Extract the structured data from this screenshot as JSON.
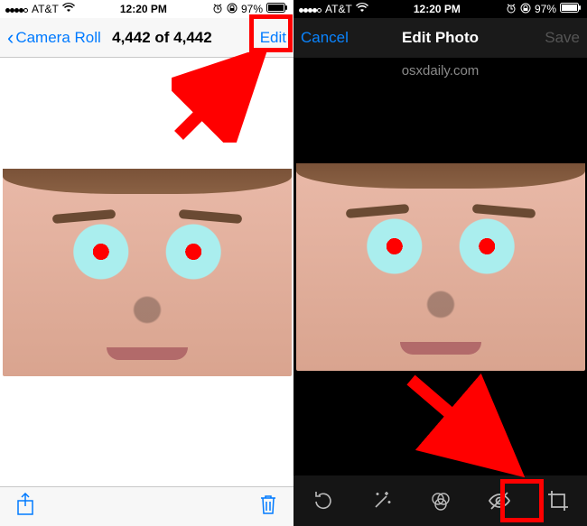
{
  "left": {
    "status": {
      "carrier": "AT&T",
      "wifi": "wifi-icon",
      "time": "12:20 PM",
      "alarm": "alarm-icon",
      "rotation": "rotation-lock-icon",
      "battery_pct": "97%"
    },
    "nav": {
      "back_label": "Camera Roll",
      "counter": "4,442 of 4,442",
      "edit_label": "Edit"
    },
    "toolbar": {
      "share": "share-icon",
      "trash": "trash-icon"
    }
  },
  "right": {
    "status": {
      "carrier": "AT&T",
      "wifi": "wifi-icon",
      "time": "12:20 PM",
      "alarm": "alarm-icon",
      "rotation": "rotation-lock-icon",
      "battery_pct": "97%"
    },
    "nav": {
      "cancel_label": "Cancel",
      "title": "Edit Photo",
      "save_label": "Save"
    },
    "watermark": "osxdaily.com",
    "tools": {
      "rotate": "rotate-icon",
      "auto_enhance": "wand-icon",
      "filters": "filters-icon",
      "redeye": "redeye-icon",
      "crop": "crop-icon"
    }
  },
  "colors": {
    "ios_blue": "#007aff",
    "ios_blue_dark": "#0a84ff",
    "annotation_red": "#ff0000"
  }
}
